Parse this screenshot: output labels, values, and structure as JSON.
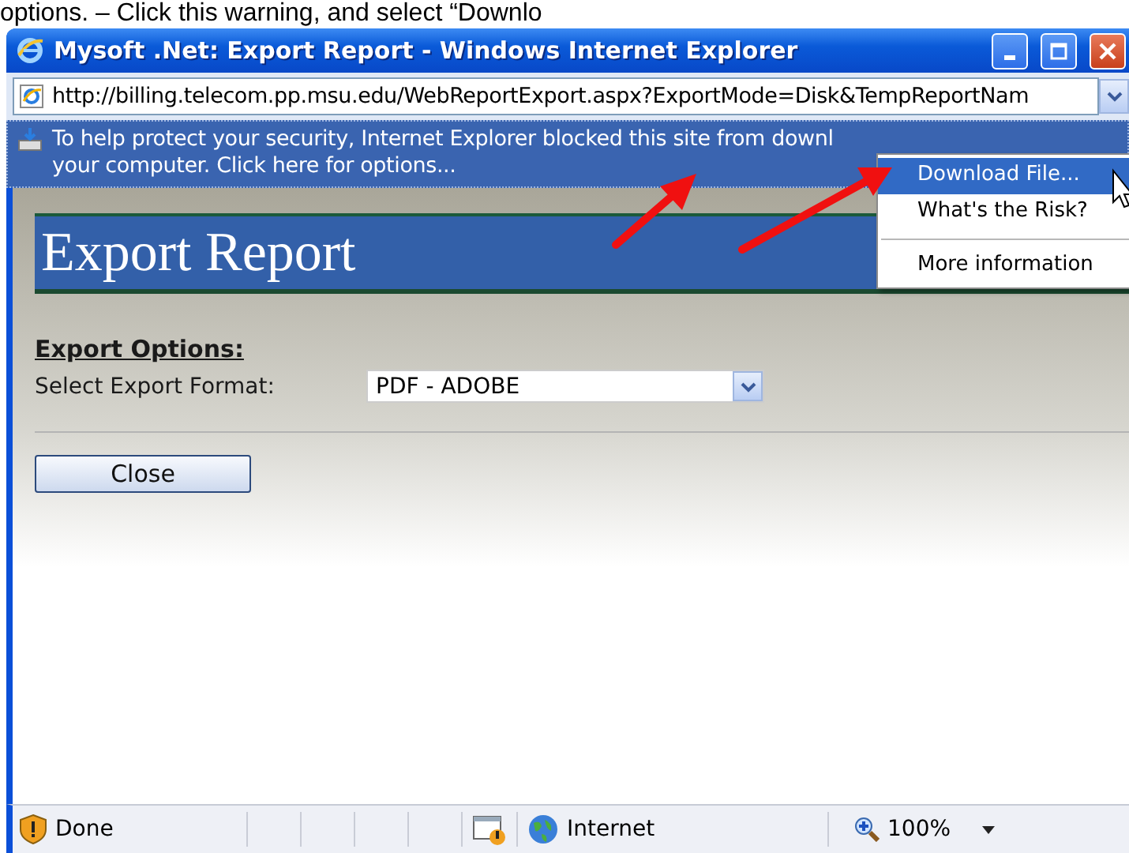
{
  "caption": "options. – Click this warning, and select “Downlo",
  "window": {
    "title": "Mysoft .Net: Export Report - Windows Internet Explorer"
  },
  "address_bar": {
    "url": "http://billing.telecom.pp.msu.edu/WebReportExport.aspx?ExportMode=Disk&TempReportNam"
  },
  "info_bar": {
    "lines": [
      "To help protect your security, Internet Explorer blocked this site from downl",
      "your computer. Click here for options..."
    ]
  },
  "menu": {
    "items": [
      {
        "kind": "item",
        "label": "Download File...",
        "selected": true
      },
      {
        "kind": "item",
        "label": "What's the Risk?",
        "selected": false
      },
      {
        "kind": "separator"
      },
      {
        "kind": "item",
        "label": "More information",
        "selected": false
      }
    ]
  },
  "page": {
    "banner": "Export Report",
    "section_heading": "Export Options:",
    "format_label": "Select Export Format:",
    "format_value": "PDF - ADOBE",
    "close_button": "Close"
  },
  "status_bar": {
    "status": "Done",
    "zone": "Internet",
    "zoom": "100%"
  }
}
